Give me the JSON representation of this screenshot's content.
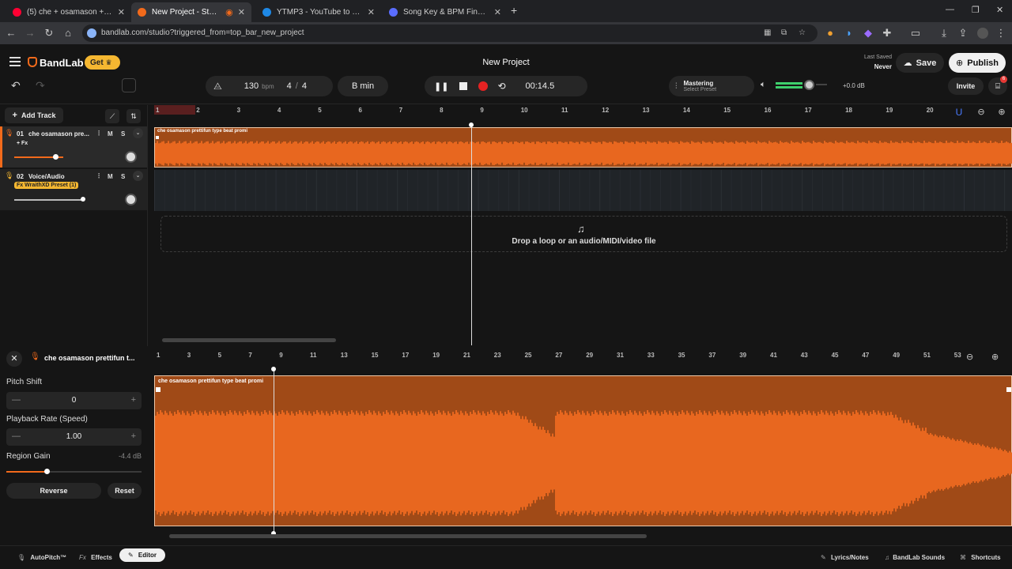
{
  "browser": {
    "tabs": [
      {
        "title": "(5) che + osamason + prettifun",
        "color": "#ff0033",
        "active": false
      },
      {
        "title": "New Project - Studio",
        "color": "#f26a1b",
        "active": true
      },
      {
        "title": "YTMP3 - YouTube to MP3 Conv",
        "color": "#1e88e5",
        "active": false
      },
      {
        "title": "Song Key & BPM Finder | Tunel",
        "color": "#5a6dff",
        "active": false
      }
    ],
    "url": "bandlab.com/studio?triggered_from=top_bar_new_project"
  },
  "app": {
    "brand": "BandLab",
    "get_label": "Get",
    "project_title": "New Project",
    "last_saved_label": "Last Saved",
    "last_saved_value": "Never",
    "save_label": "Save",
    "publish_label": "Publish",
    "invite_label": "Invite",
    "notif_count": "6"
  },
  "transport": {
    "bpm_value": "130",
    "bpm_unit": "bpm",
    "time_sig_num": "4",
    "time_sig_sep": "/",
    "time_sig_den": "4",
    "key": "B min",
    "time": "00:14.5",
    "mastering_label": "Mastering",
    "mastering_preset": "Select Preset",
    "master_volume": "+0.0 dB"
  },
  "tracks": {
    "add_track_label": "Add Track",
    "list": [
      {
        "num": "01",
        "name": "che  osamason  pre...",
        "fx": "+ Fx",
        "m": "M",
        "s": "S"
      },
      {
        "num": "02",
        "name": "Voice/Audio",
        "fx": "Fx  WraithXD Preset (1)",
        "m": "M",
        "s": "S"
      }
    ]
  },
  "timeline": {
    "ruler": [
      "1",
      "2",
      "3",
      "4",
      "5",
      "6",
      "7",
      "8",
      "9",
      "10",
      "11",
      "12",
      "13",
      "14",
      "15",
      "16",
      "17",
      "18",
      "19",
      "20"
    ],
    "region_title": "che  osamason  prettifun type beat promi",
    "drop_text": "Drop a loop or an audio/MIDI/video file"
  },
  "editor": {
    "region_name": "che osamason prettifun t...",
    "pitch_shift_label": "Pitch Shift",
    "pitch_shift_value": "0",
    "playback_rate_label": "Playback Rate (Speed)",
    "playback_rate_value": "1.00",
    "region_gain_label": "Region Gain",
    "region_gain_value": "-4.4 dB",
    "reverse_label": "Reverse",
    "reset_label": "Reset",
    "ruler": [
      "1",
      "3",
      "5",
      "7",
      "9",
      "11",
      "13",
      "15",
      "17",
      "19",
      "21",
      "23",
      "25",
      "27",
      "29",
      "31",
      "33",
      "35",
      "37",
      "39",
      "41",
      "43",
      "45",
      "47",
      "49",
      "51",
      "53"
    ],
    "region_title": "che  osamason  prettifun type beat promi"
  },
  "footer": {
    "autopitch": "AutoPitch™",
    "effects": "Effects",
    "editor": "Editor",
    "lyrics": "Lyrics/Notes",
    "sounds": "BandLab Sounds",
    "shortcuts": "Shortcuts"
  },
  "colors": {
    "accent": "#f26a1b",
    "wave": "#e8671f",
    "region_bg": "#a04a17",
    "dark": "#151515"
  }
}
